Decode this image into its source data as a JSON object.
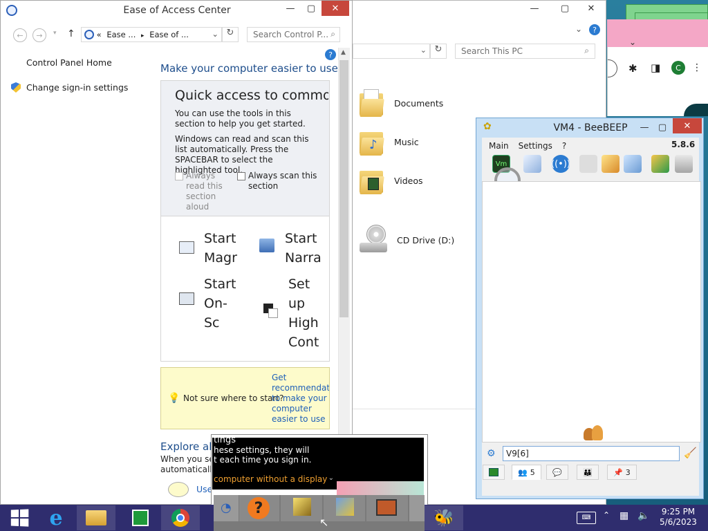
{
  "ease_of_access": {
    "title": "Ease of Access Center",
    "breadcrumb_1": "Ease ...",
    "breadcrumb_2": "Ease of ...",
    "breadcrumb_prefix": "«",
    "search_placeholder": "Search Control P...",
    "left_nav": {
      "home": "Control Panel Home",
      "sign_in": "Change sign-in settings"
    },
    "heading": "Make your computer easier to use",
    "quick_access": {
      "heading": "Quick access to commo",
      "intro": "You can use the tools in this section to help you get started.",
      "scan_text": "Windows can read and scan this list automatically.  Press the SPACEBAR to select the highlighted tool.",
      "always_read": "Always read this section aloud",
      "always_scan": "Always scan this section"
    },
    "tools": {
      "magnifier": "Start\nMagr",
      "narrator": "Start\nNarra",
      "keyboard": "Start\nOn-Sc\nKeybo",
      "contrast": "Set\nup\nHigh\nCont"
    },
    "recommend": {
      "question": "Not sure where to start?",
      "link": "Get recommendat to make your computer easier to use"
    },
    "explore": {
      "heading": "Explore all",
      "text_1": "When you sel",
      "text_2": "automatically",
      "use_link": "Use"
    }
  },
  "explorer": {
    "search_placeholder": "Search This PC",
    "items": [
      {
        "label": "Documents"
      },
      {
        "label": "Music"
      },
      {
        "label": "Videos"
      },
      {
        "label": "CD Drive (D:)"
      }
    ]
  },
  "popup": {
    "line_1": "tings",
    "line_2": "hese settings, they will",
    "line_3": "t each time you sign in.",
    "line_4": "computer without a display"
  },
  "beebeep": {
    "title": "VM4 - BeeBEEP",
    "menu": [
      "Main",
      "Settings",
      "?"
    ],
    "version": "5.8.6",
    "input_value": "V9[6]",
    "tab_counts": {
      "users": "5",
      "groups": "3"
    }
  },
  "chrome": {
    "avatar_letter": "C"
  },
  "taskbar": {
    "time": "9:25 PM",
    "date": "5/6/2023"
  },
  "colors": {
    "taskbar": "#2f2d6e",
    "link_blue": "#1e4e8c",
    "close_red": "#c7473c"
  }
}
